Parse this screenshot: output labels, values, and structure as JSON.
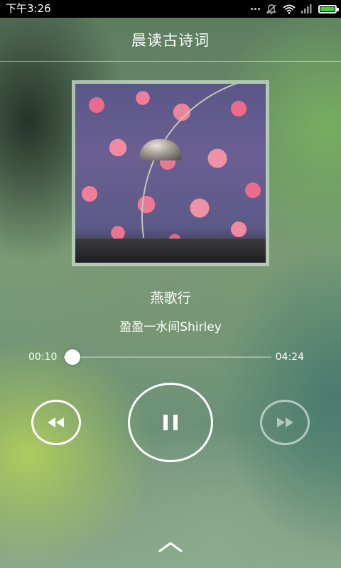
{
  "status_bar": {
    "time": "下午3:26",
    "icons": [
      "dots-icon",
      "mute-icon",
      "wifi-icon",
      "signal-icon",
      "battery-icon"
    ],
    "battery_color": "#39d23a"
  },
  "header": {
    "title": "晨读古诗词"
  },
  "player": {
    "song_title": "燕歌行",
    "artist": "盈盈一水间Shirley",
    "elapsed": "00:10",
    "duration": "04:24",
    "progress": 0.04,
    "controls": {
      "prev_icon": "rewind-icon",
      "play_pause_icon": "pause-icon",
      "next_icon": "fast-forward-icon",
      "next_enabled": false
    },
    "expand_icon": "chevron-up-icon"
  }
}
